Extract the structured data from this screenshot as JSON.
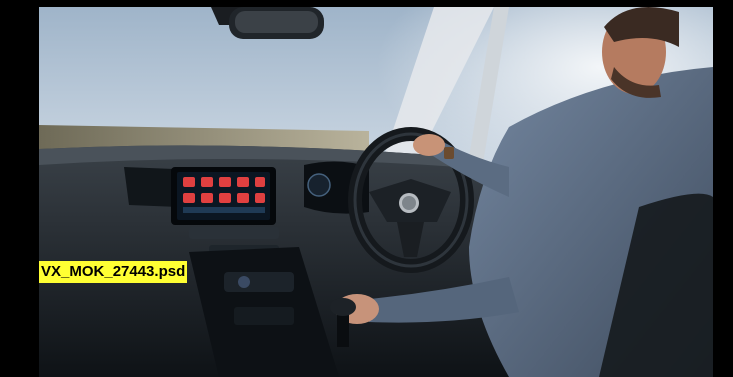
{
  "file_label": "VX_MOK_27443.psd",
  "photo": {
    "description_icon": "car-interior-photo",
    "colors": {
      "background": "#000000",
      "label_highlight": "#ffff33",
      "sky": "#c9d6e2",
      "dashboard": "#1b2127",
      "sweater": "#5d6f85"
    }
  }
}
